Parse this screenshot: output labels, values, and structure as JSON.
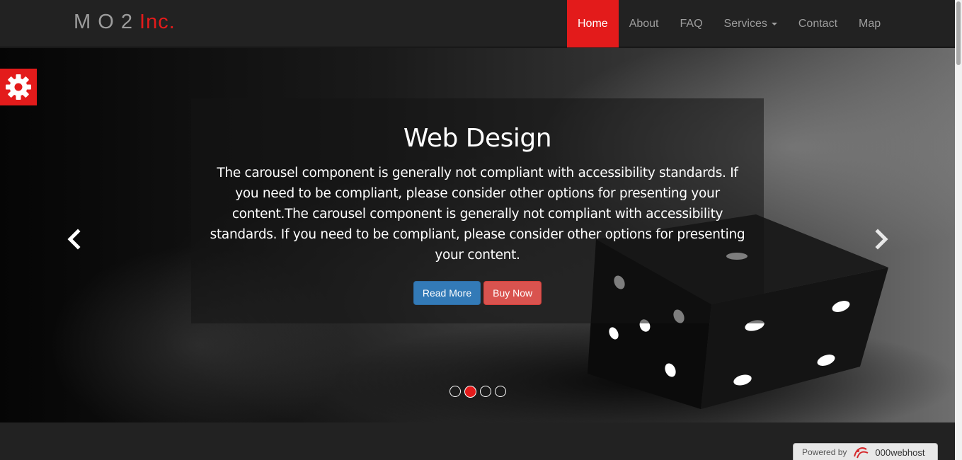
{
  "brand": {
    "part1": "M O 2",
    "part2": "Inc."
  },
  "nav": {
    "items": [
      {
        "label": "Home"
      },
      {
        "label": "About"
      },
      {
        "label": "FAQ"
      },
      {
        "label": "Services"
      },
      {
        "label": "Contact"
      },
      {
        "label": "Map"
      }
    ]
  },
  "carousel": {
    "title": "Web Design",
    "text": "The carousel component is generally not compliant with accessibility standards. If you need to be compliant, please consider other options for presenting your content.The carousel component is generally not compliant with accessibility standards. If you need to be compliant, please consider other options for presenting your content.",
    "primary_button": "Read More",
    "secondary_button": "Buy Now",
    "indicator_count": 4,
    "active_indicator": 2
  },
  "settings": {
    "icon": "gear-icon"
  },
  "footer_badge": {
    "label": "Powered by",
    "host": "000webhost"
  },
  "colors": {
    "accent": "#e31b1b",
    "navbar": "#222222",
    "primary": "#337ab7",
    "danger": "#d9534f"
  }
}
